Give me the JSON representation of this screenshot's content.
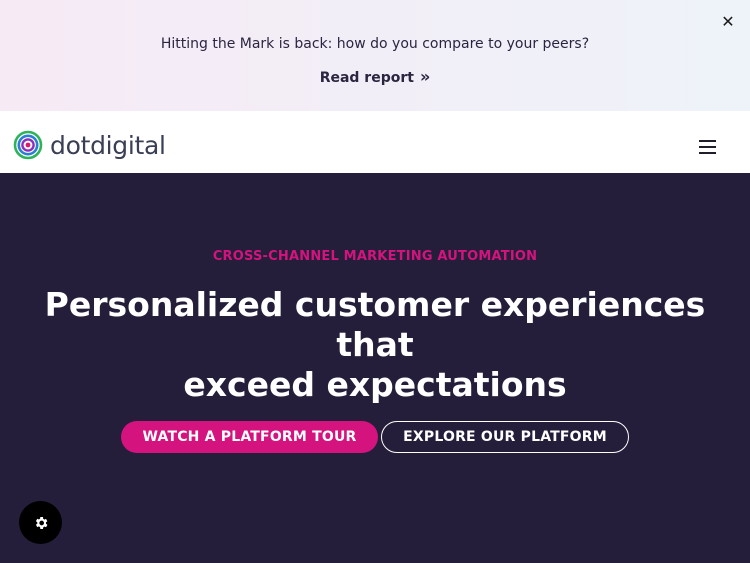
{
  "banner": {
    "text": "Hitting the Mark is back: how do you compare to your peers?",
    "link_label": "Read report",
    "link_chevron": "»",
    "close_glyph": "✕"
  },
  "navbar": {
    "brand": "dotdigital",
    "menu_icon": "hamburger-icon"
  },
  "hero": {
    "eyebrow": "CROSS-CHANNEL MARKETING AUTOMATION",
    "headline_line1": "Personalized customer experiences that",
    "headline_line2": "exceed expectations",
    "primary_cta": "WATCH A PLATFORM TOUR",
    "secondary_cta": "EXPLORE OUR PLATFORM"
  },
  "cookie": {
    "icon": "gear-icon"
  },
  "colors": {
    "accent": "#d4137e",
    "hero_bg": "#251e3a",
    "text_dark": "#2b2540"
  }
}
